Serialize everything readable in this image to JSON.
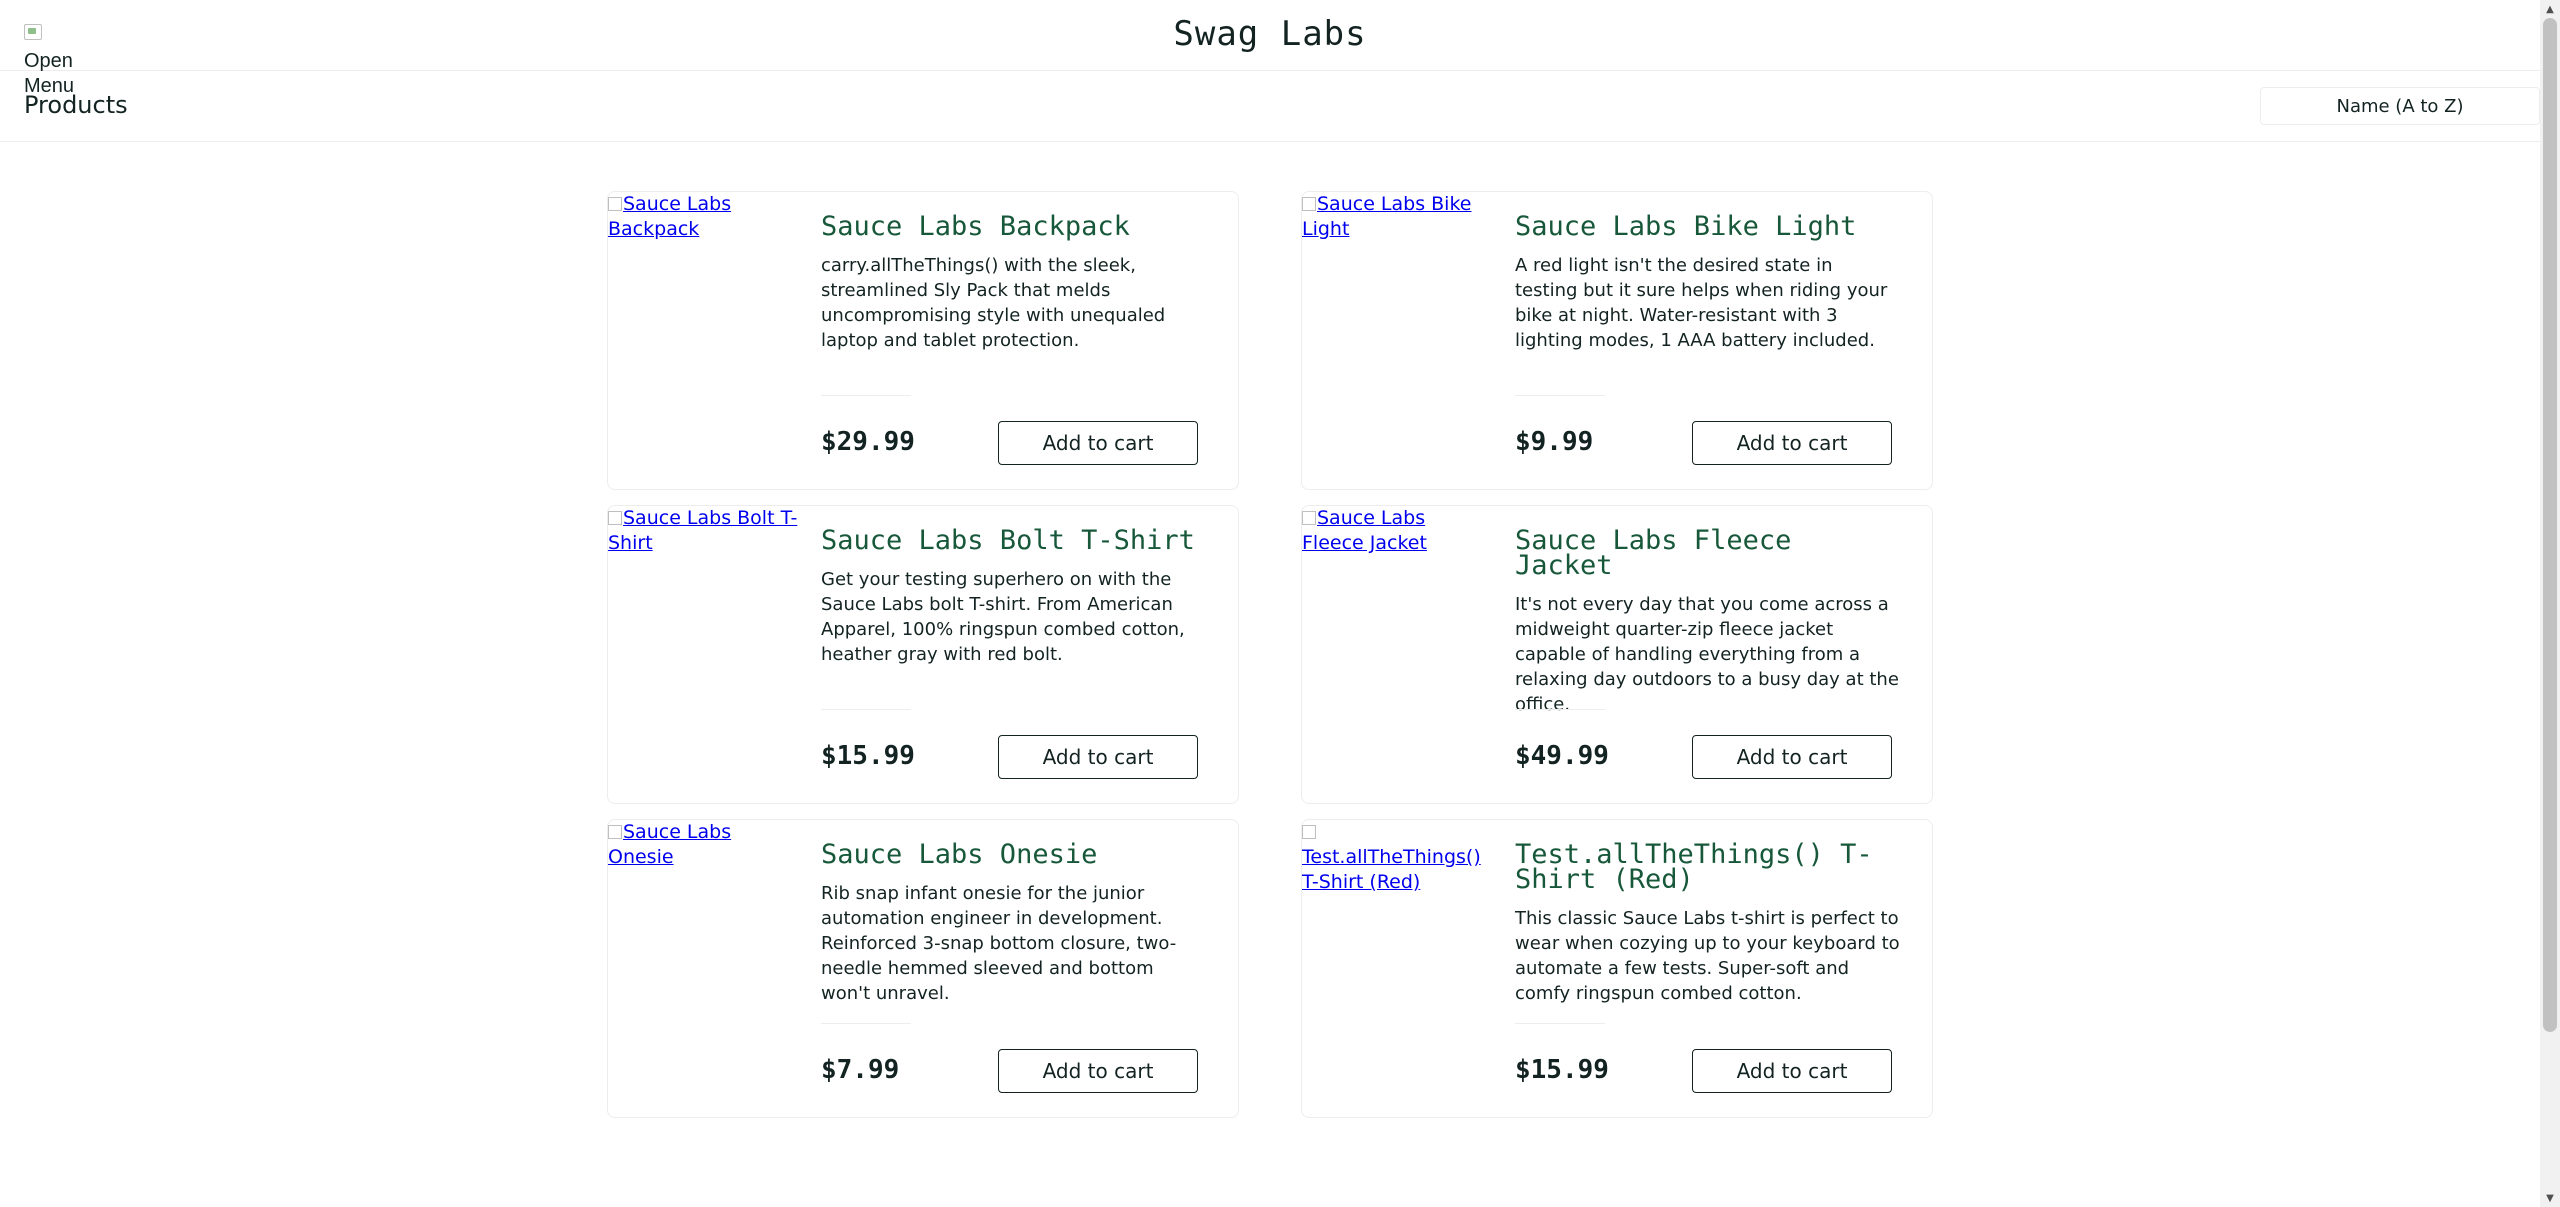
{
  "header": {
    "menu_label": "Open Menu",
    "logo": "Swag Labs"
  },
  "secondary": {
    "title": "Products",
    "sort_value": "Name (A to Z)"
  },
  "products": [
    {
      "image_alt": "Sauce Labs Backpack",
      "name": "Sauce Labs Backpack",
      "description": "carry.allTheThings() with the sleek, streamlined Sly Pack that melds uncompromising style with unequaled laptop and tablet protection.",
      "price": "$29.99",
      "button": "Add to cart"
    },
    {
      "image_alt": "Sauce Labs Bike Light",
      "name": "Sauce Labs Bike Light",
      "description": "A red light isn't the desired state in testing but it sure helps when riding your bike at night. Water-resistant with 3 lighting modes, 1 AAA battery included.",
      "price": "$9.99",
      "button": "Add to cart"
    },
    {
      "image_alt": "Sauce Labs Bolt T-Shirt",
      "name": "Sauce Labs Bolt T-Shirt",
      "description": "Get your testing superhero on with the Sauce Labs bolt T-shirt. From American Apparel, 100% ringspun combed cotton, heather gray with red bolt.",
      "price": "$15.99",
      "button": "Add to cart"
    },
    {
      "image_alt": "Sauce Labs Fleece Jacket",
      "name": "Sauce Labs Fleece Jacket",
      "description": "It's not every day that you come across a midweight quarter-zip fleece jacket capable of handling everything from a relaxing day outdoors to a busy day at the office.",
      "price": "$49.99",
      "button": "Add to cart"
    },
    {
      "image_alt": "Sauce Labs Onesie",
      "name": "Sauce Labs Onesie",
      "description": "Rib snap infant onesie for the junior automation engineer in development. Reinforced 3-snap bottom closure, two-needle hemmed sleeved and bottom won't unravel.",
      "price": "$7.99",
      "button": "Add to cart"
    },
    {
      "image_alt": "Test.allTheThings() T-Shirt (Red)",
      "name": "Test.allTheThings() T-Shirt (Red)",
      "description": "This classic Sauce Labs t-shirt is perfect to wear when cozying up to your keyboard to automate a few tests. Super-soft and comfy ringspun combed cotton.",
      "price": "$15.99",
      "button": "Add to cart"
    }
  ],
  "colors": {
    "product_name": "#18583a",
    "link": "#0000ee",
    "text": "#132322",
    "border": "#ededed"
  },
  "icons": {
    "menu": "broken-image-icon",
    "scroll_up": "triangle-up-icon",
    "scroll_down": "triangle-down-icon"
  }
}
